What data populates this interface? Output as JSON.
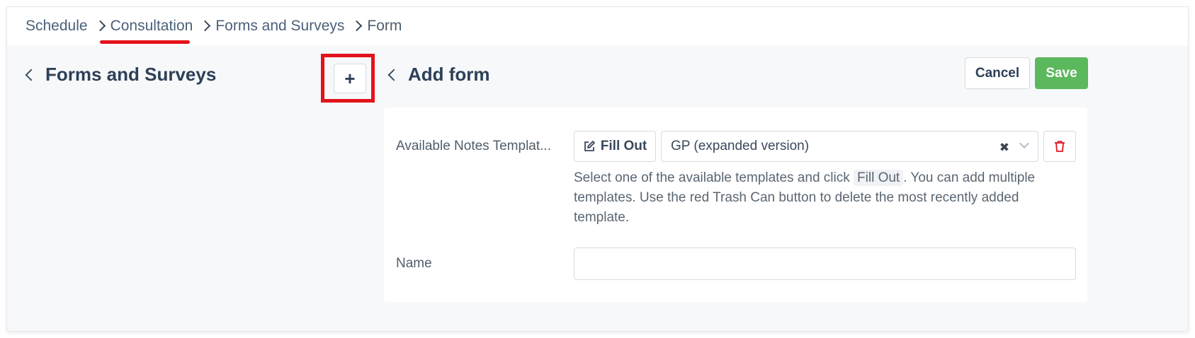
{
  "breadcrumb": {
    "items": [
      "Schedule",
      "Consultation",
      "Forms and Surveys"
    ],
    "current": "Form"
  },
  "left_panel": {
    "title": "Forms and Surveys",
    "add_label": "+"
  },
  "form": {
    "title": "Add form",
    "cancel_label": "Cancel",
    "save_label": "Save",
    "templates_label": "Available Notes Templat...",
    "fill_out_label": "Fill Out",
    "selected_template": "GP (expanded version)",
    "clear_symbol": "✖",
    "help_before": "Select one of the available templates and click ",
    "help_chip": "Fill Out",
    "help_after": ". You can add multiple templates. Use the red Trash Can button to delete the most recently added template.",
    "name_label": "Name",
    "name_value": ""
  },
  "colors": {
    "accent": "#2d4057",
    "save": "#5cb85c",
    "annotation": "#e3121b",
    "trash": "#e3121b"
  },
  "icons": [
    "chevron-right-icon",
    "chevron-left-icon",
    "edit-icon",
    "clear-icon",
    "chevron-down-icon",
    "trash-icon"
  ]
}
